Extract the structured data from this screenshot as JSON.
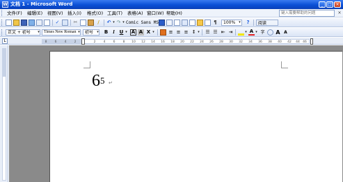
{
  "window": {
    "title": "文档 1 - Microsoft Word",
    "app_icon": "W"
  },
  "menu": {
    "items": [
      "文件(F)",
      "编辑(E)",
      "视图(V)",
      "插入(I)",
      "格式(O)",
      "工具(T)",
      "表格(A)",
      "窗口(W)",
      "帮助(H)"
    ],
    "help_placeholder": "键入需要帮助的问题",
    "close_glyph": "×"
  },
  "standard_toolbar": {
    "font_preview": "Comic Sans MS",
    "zoom": "100%",
    "read_label": "阅读"
  },
  "format_toolbar": {
    "style": "正文 + 初号",
    "font": "Times New Roman",
    "size": "初号",
    "bold": "B",
    "italic": "I",
    "underline": "U",
    "char_border": "A",
    "char_shading": "A",
    "scale": "X",
    "font_color": "A",
    "phonetic": "字",
    "grow": "A",
    "shrink": "A"
  },
  "ruler": {
    "numbers": [
      "8",
      "6",
      "4",
      "2",
      "2",
      "4",
      "6",
      "8",
      "10",
      "12",
      "14",
      "16",
      "18",
      "20",
      "22",
      "24",
      "26",
      "28",
      "30",
      "32",
      "34",
      "36",
      "38",
      "40",
      "42",
      "44",
      "46",
      "48"
    ],
    "tab_selector": "L"
  },
  "document": {
    "base": "6",
    "exponent": "5",
    "paragraph_mark": "↵"
  },
  "colors": {
    "title_bar": "#0a4fd6",
    "highlight": "#f2e600",
    "font_red": "#e02020",
    "border_orange": "#e07020"
  }
}
